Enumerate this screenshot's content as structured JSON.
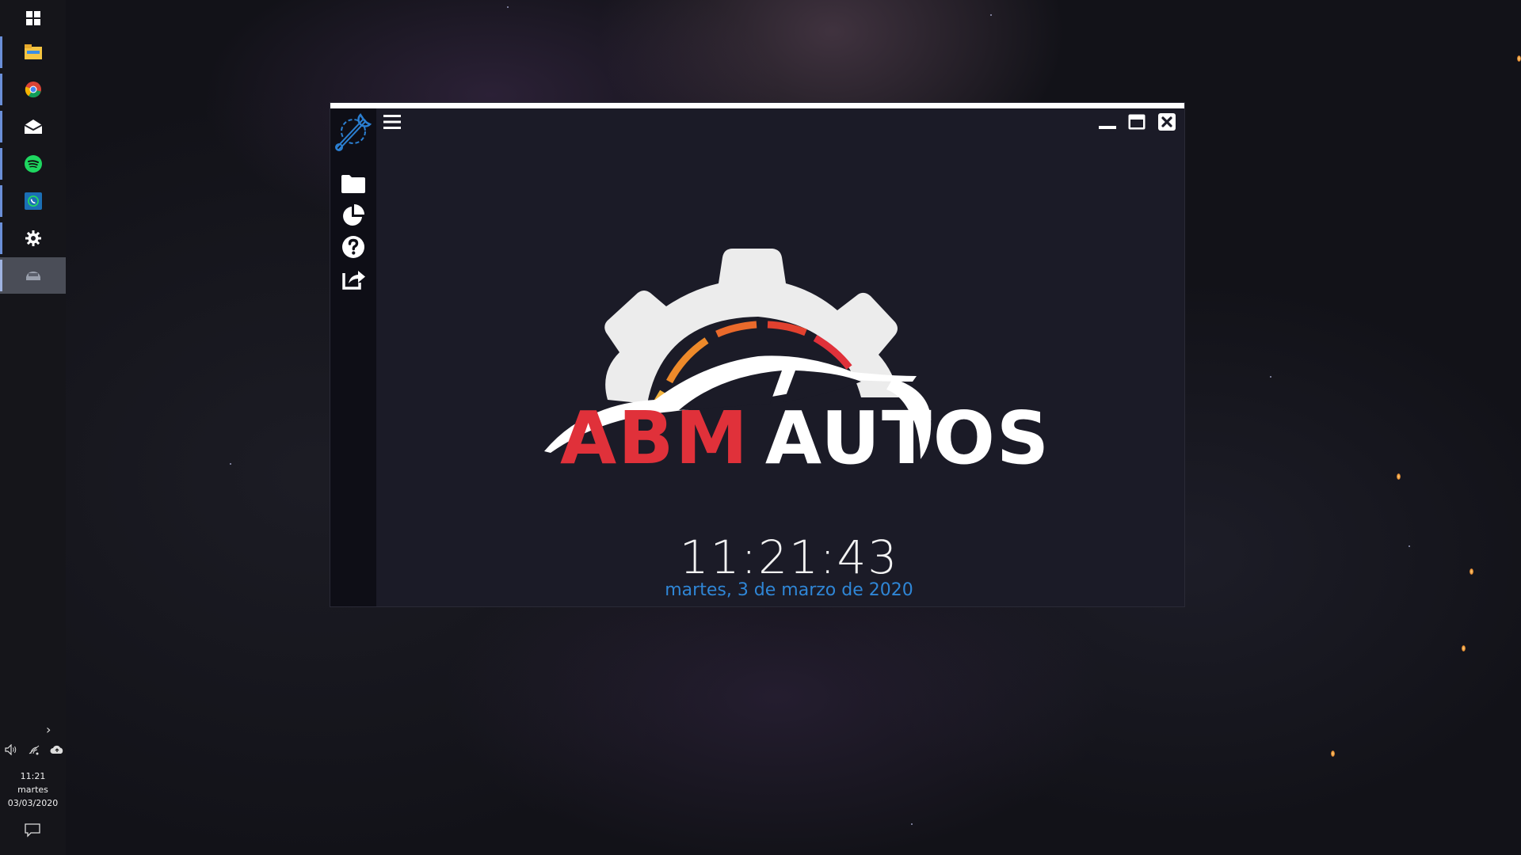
{
  "desktop": {
    "background": "starfield"
  },
  "taskbar": {
    "items": [
      {
        "icon": "windows-start-icon"
      },
      {
        "icon": "file-explorer-icon"
      },
      {
        "icon": "chrome-icon"
      },
      {
        "icon": "mail-icon"
      },
      {
        "icon": "spotify-icon"
      },
      {
        "icon": "whatsapp-icon"
      },
      {
        "icon": "settings-gear-icon"
      },
      {
        "icon": "abm-autos-app-icon"
      }
    ],
    "tray": {
      "expand": "›",
      "time": "11:21",
      "day": "martes",
      "date": "03/03/2020"
    }
  },
  "window": {
    "brand_primary": "ABM",
    "brand_secondary": "AUTOS",
    "clock_time": "11:21:43",
    "clock_date": "martes, 3 de marzo de 2020",
    "colors": {
      "brand_red": "#e0313a",
      "date_blue": "#2f86d6",
      "panel_bg": "#1b1b27",
      "sidebar_bg": "#0e0e16"
    }
  }
}
